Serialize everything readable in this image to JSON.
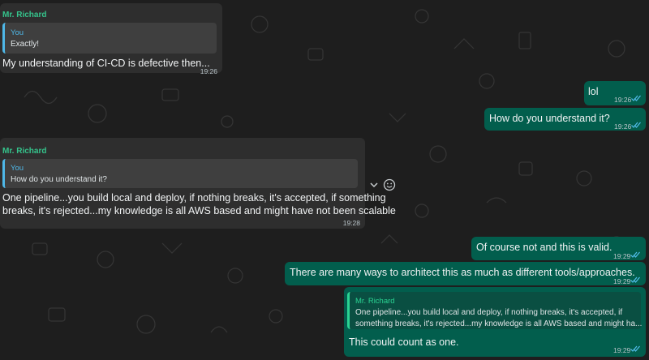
{
  "colors": {
    "background": "#1e1e1e",
    "incoming_bubble": "#2e2e2e",
    "outgoing_bubble": "#025e4d",
    "sender_name": "#35c48c",
    "read_ticks": "#53bdeb"
  },
  "messages": [
    {
      "direction": "incoming",
      "sender": "Mr. Richard",
      "quote": {
        "author": "You",
        "text": "Exactly!"
      },
      "text": "My understanding of CI-CD is defective then...",
      "time": "19:26"
    },
    {
      "direction": "outgoing",
      "text": "lol",
      "time": "19:26",
      "status": "read"
    },
    {
      "direction": "outgoing",
      "text": "How do you understand it?",
      "time": "19:26",
      "status": "read"
    },
    {
      "direction": "incoming",
      "sender": "Mr. Richard",
      "quote": {
        "author": "You",
        "text": "How do you understand it?"
      },
      "text_line1": "One pipeline...you build local and deploy, if nothing breaks, it's accepted, if something",
      "text_line2": "breaks, it's rejected...my knowledge is all AWS based and might have not been scalable",
      "time": "19:28"
    },
    {
      "direction": "outgoing",
      "text": "Of course not and this is valid.",
      "time": "19:29",
      "status": "read"
    },
    {
      "direction": "outgoing",
      "text": "There are many ways to architect this as much as different tools/approaches.",
      "time": "19:29",
      "status": "read"
    },
    {
      "direction": "outgoing",
      "quote": {
        "author": "Mr. Richard",
        "text_line1": "One pipeline...you build local and deploy, if nothing breaks, it's accepted, if",
        "text_line2": "something breaks, it's rejected...my knowledge is all AWS based and might ha..."
      },
      "text": "This could count as one.",
      "time": "19:29",
      "status": "read"
    }
  ],
  "hover_actions": {
    "menu_icon": "chevron-down-icon",
    "react_icon": "emoji-smile-icon"
  }
}
